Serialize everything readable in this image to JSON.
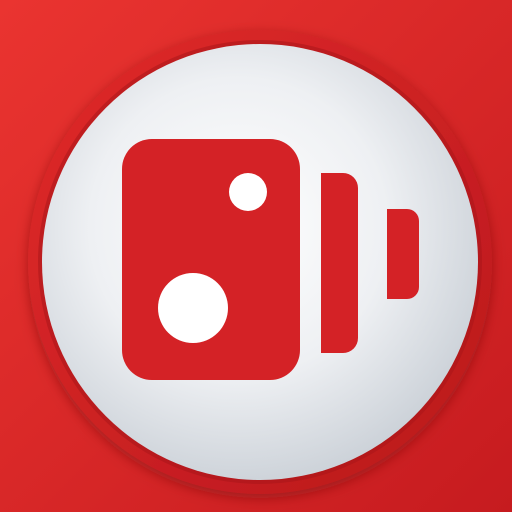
{
  "icon": {
    "name": "speed-camera-app-icon",
    "symbol": "speed-camera-icon",
    "colors": {
      "background_light": "#ea3430",
      "background_dark": "#c61b1f",
      "ring_outer": "#e02a2a",
      "ring_inner": "#b9181c",
      "disc_center": "#ffffff",
      "disc_edge": "#c9cfd6",
      "glyph": "#d42226"
    }
  }
}
